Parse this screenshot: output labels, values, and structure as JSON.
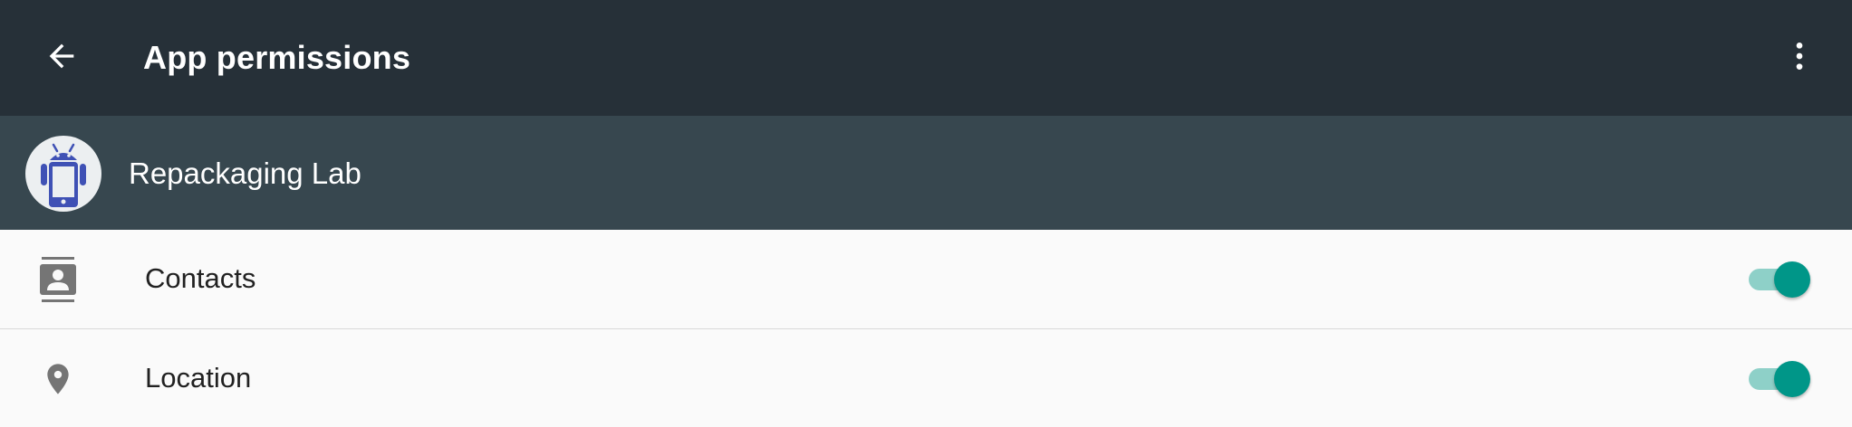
{
  "toolbar": {
    "title": "App permissions",
    "back_icon": "arrow-back-icon",
    "overflow_icon": "more-vert-icon"
  },
  "app": {
    "name": "Repackaging Lab",
    "icon": "android-phone-icon"
  },
  "permissions": [
    {
      "label": "Contacts",
      "icon": "contacts-icon",
      "enabled": true
    },
    {
      "label": "Location",
      "icon": "location-pin-icon",
      "enabled": true
    }
  ],
  "colors": {
    "toolbar_bg": "#263038",
    "header_bg": "#37474f",
    "accent": "#009688",
    "accent_track": "#8ed0c8",
    "icon_gray": "#757575"
  }
}
